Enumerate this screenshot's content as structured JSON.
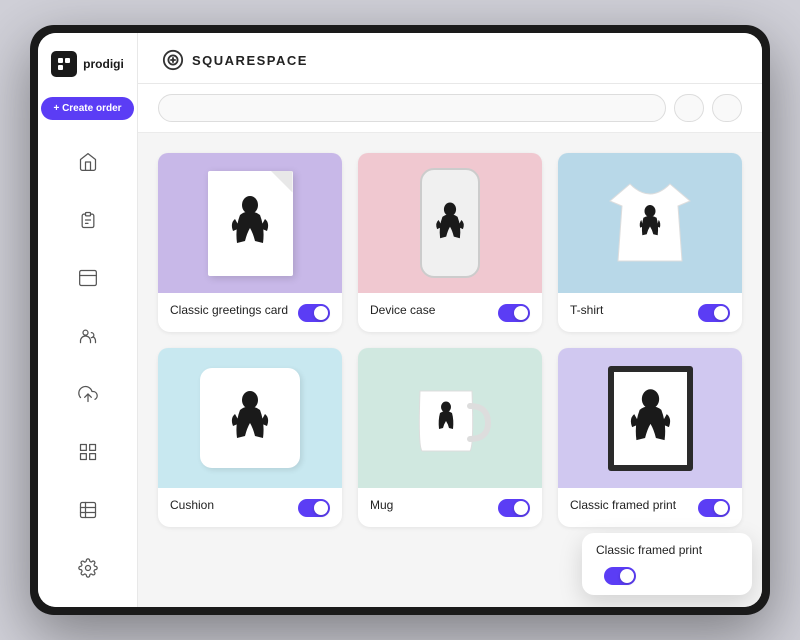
{
  "app": {
    "name": "prodigi",
    "platform": "SQUARESPACE"
  },
  "sidebar": {
    "create_order_label": "+ Create order",
    "nav_items": [
      {
        "name": "home",
        "icon": "home-icon"
      },
      {
        "name": "orders",
        "icon": "clipboard-icon"
      },
      {
        "name": "products",
        "icon": "archive-icon"
      },
      {
        "name": "team",
        "icon": "users-icon"
      },
      {
        "name": "upload",
        "icon": "upload-icon"
      },
      {
        "name": "apps",
        "icon": "grid-icon"
      },
      {
        "name": "analytics",
        "icon": "bar-chart-icon"
      },
      {
        "name": "settings",
        "icon": "settings-icon"
      }
    ]
  },
  "toolbar": {
    "search_placeholder": "",
    "btn1_label": "",
    "btn2_label": ""
  },
  "products": [
    {
      "id": "greeting-card",
      "name": "Classic greetings card",
      "bg_class": "purple",
      "enabled": true
    },
    {
      "id": "device-case",
      "name": "Device case",
      "bg_class": "pink",
      "enabled": true
    },
    {
      "id": "tshirt",
      "name": "T-shirt",
      "bg_class": "blue",
      "enabled": true
    },
    {
      "id": "pillow",
      "name": "Cushion",
      "bg_class": "light-blue",
      "enabled": true
    },
    {
      "id": "mug",
      "name": "Mug",
      "bg_class": "light-green",
      "enabled": true
    },
    {
      "id": "framed-print",
      "name": "Classic framed print",
      "bg_class": "light-purple",
      "enabled": true
    }
  ],
  "tooltip": {
    "product_name": "Classic framed print"
  }
}
